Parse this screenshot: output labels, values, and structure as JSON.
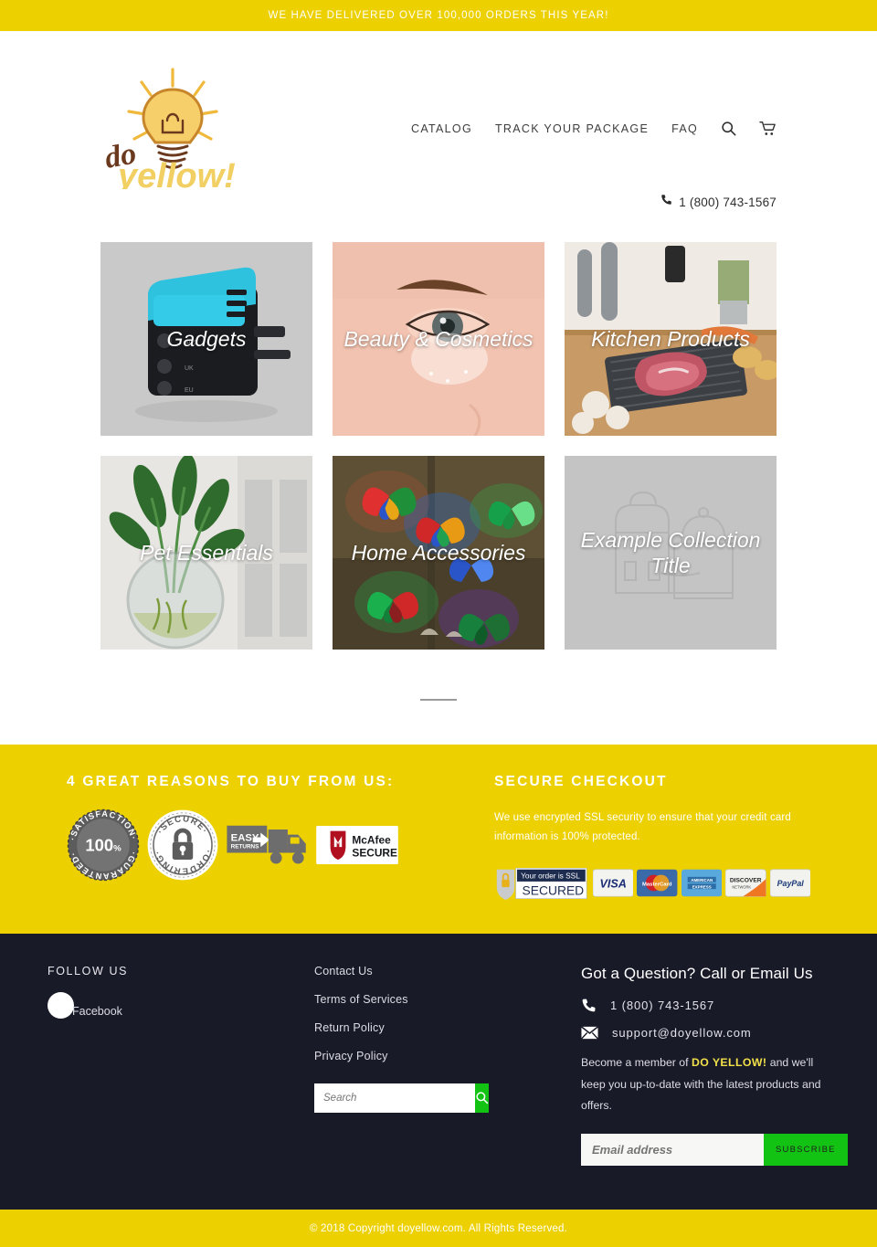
{
  "announcement": {
    "text": "WE HAVE DELIVERED OVER 100,000 ORDERS THIS YEAR!"
  },
  "brand": {
    "word_do": "do",
    "word_yellow": "yellow!",
    "logo_icon": "lightbulb-shopping-bag-logo"
  },
  "nav": {
    "items": [
      {
        "label": "CATALOG"
      },
      {
        "label": "TRACK YOUR PACKAGE"
      },
      {
        "label": "FAQ"
      }
    ],
    "search_icon": "search-icon",
    "cart_icon": "cart-icon"
  },
  "header_phone": {
    "icon": "phone-icon",
    "number": "1 (800) 743-1567"
  },
  "collections": [
    {
      "title": "Gadgets",
      "image": "blue-travel-adapter-on-grey"
    },
    {
      "title": "Beauty & Cosmetics",
      "image": "woman-eye-with-under-eye-patch"
    },
    {
      "title": "Kitchen Products",
      "image": "steak-on-defrosting-tray-in-kitchen"
    },
    {
      "title": "Pet Essentials",
      "image": "wall-mounted-glass-fish-bowl-plant"
    },
    {
      "title": "Home Accessories",
      "image": "led-butterfly-wall-lights"
    },
    {
      "title": "Example Collection Title",
      "image": "placeholder-bags-outline"
    }
  ],
  "reasons": {
    "heading": "4 GREAT REASONS TO BUY FROM US:",
    "badges": [
      {
        "name": "satisfaction-guaranteed-badge",
        "top_text": "SATISFACTION",
        "center_text": "100%",
        "bottom_text": "GUARANTEED"
      },
      {
        "name": "secure-ordering-badge",
        "top_text": "SECURE",
        "bottom_text": "ORDERING",
        "icon": "padlock-icon"
      },
      {
        "name": "easy-returns-truck-badge",
        "line1": "EASY",
        "line2": "RETURNS"
      },
      {
        "name": "mcafee-secure-badge",
        "line1": "McAfee",
        "line2": "SECURE"
      }
    ]
  },
  "secure_checkout": {
    "heading": "SECURE CHECKOUT",
    "body": "We use encrypted SSL security to ensure that your credit card information is 100% protected.",
    "payments": [
      {
        "name": "ssl-secured-badge",
        "line1": "Your order is SSL",
        "line2": "SECURED"
      },
      {
        "name": "visa-badge",
        "label": "VISA"
      },
      {
        "name": "mastercard-badge",
        "label": "MasterCard"
      },
      {
        "name": "amex-badge",
        "line1": "AMERICAN",
        "line2": "EXPRESS"
      },
      {
        "name": "discover-badge",
        "line1": "DISCOVER",
        "line2": "NETWORK"
      },
      {
        "name": "paypal-badge",
        "label": "PayPal"
      }
    ]
  },
  "footer": {
    "follow_heading": "FOLLOW US",
    "facebook_label": "Facebook",
    "links": [
      {
        "label": "Contact Us"
      },
      {
        "label": "Terms of Services"
      },
      {
        "label": "Return Policy"
      },
      {
        "label": "Privacy Policy"
      }
    ],
    "search": {
      "placeholder": "Search",
      "value": "",
      "button_icon": "search-icon"
    },
    "contact": {
      "heading": "Got a Question? Call or Email Us",
      "phone_icon": "phone-icon",
      "phone": "1 (800) 743-1567",
      "email_icon": "envelope-icon",
      "email": "support@doyellow.com"
    },
    "newsletter": {
      "text_before": "Become a member of ",
      "brand": "DO YELLOW!",
      "text_after": " and we'll keep you up-to-date with the latest products and offers.",
      "placeholder": "Email address",
      "value": "",
      "button_label": "SUBSCRIBE"
    }
  },
  "copyright": {
    "text": "© 2018 Copyright doyellow.com. All Rights Reserved."
  },
  "colors": {
    "brand_yellow": "#edd000",
    "footer_dark": "#191a28",
    "accent_green": "#13c313",
    "logo_brown": "#6b3a1e",
    "logo_yellow": "#f0c44a"
  }
}
